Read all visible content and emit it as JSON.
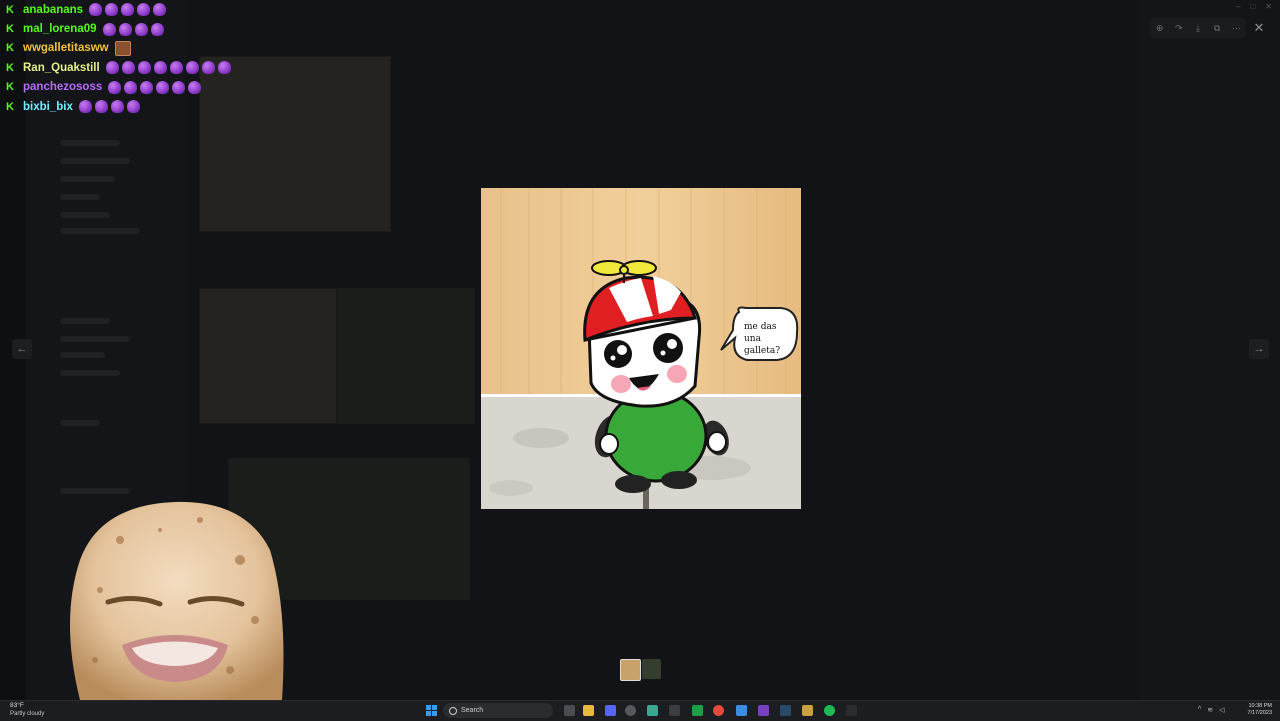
{
  "chat": {
    "messages": [
      {
        "username": "anabanans",
        "color": "#53fc18",
        "emotes": 5,
        "emote_type": "purple"
      },
      {
        "username": "mal_lorena09",
        "color": "#53fc18",
        "emotes": 4,
        "emote_type": "purple"
      },
      {
        "username": "wwgalletitasww",
        "color": "#f0c040",
        "emotes": 1,
        "emote_type": "cookie"
      },
      {
        "username": "Ran_Quakstill",
        "color": "#e6f08a",
        "emotes": 8,
        "emote_type": "purple"
      },
      {
        "username": "panchezososs",
        "color": "#b86bff",
        "emotes": 6,
        "emote_type": "purple"
      },
      {
        "username": "bixbi_bix",
        "color": "#6ff0ff",
        "emotes": 4,
        "emote_type": "purple"
      }
    ],
    "badge": "K"
  },
  "viewer": {
    "speech_bubble": [
      "me das",
      "una",
      "galleta?"
    ]
  },
  "taskbar": {
    "weather_temp": "83°F",
    "weather_desc": "Partly cloudy",
    "search_placeholder": "Search",
    "time": "10:38 PM",
    "date": "7/17/2023"
  },
  "icons": {
    "prev": "chevron-left-icon",
    "next": "chevron-right-icon",
    "close": "close-icon"
  }
}
